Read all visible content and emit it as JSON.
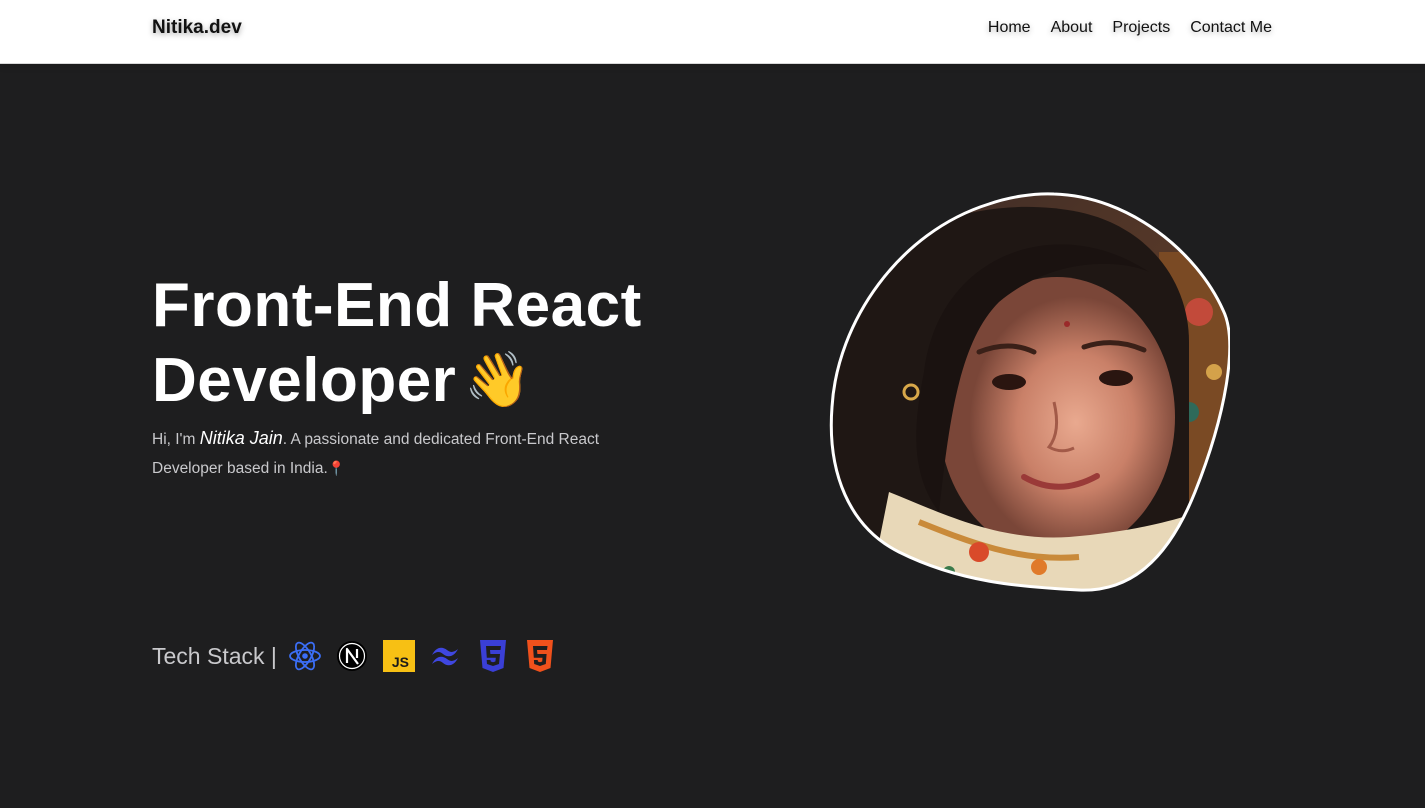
{
  "nav": {
    "brand": "Nitika.dev",
    "links": [
      "Home",
      "About",
      "Projects",
      "Contact Me"
    ]
  },
  "hero": {
    "title_line1": "Front-End React",
    "title_line2": "Developer",
    "wave_emoji": "👋",
    "intro_prefix": "Hi, I'm ",
    "name": "Nitika Jain",
    "intro_suffix": ". A passionate and dedicated Front-End React Developer based in India.",
    "pin_emoji": "📍"
  },
  "tech_stack": {
    "label": "Tech Stack |",
    "icons": [
      {
        "name": "react-icon",
        "color": "#3b6ef5"
      },
      {
        "name": "nextjs-icon",
        "color": "#000000"
      },
      {
        "name": "javascript-icon",
        "color": "#f7c014"
      },
      {
        "name": "tailwind-icon",
        "color": "#3f47e0"
      },
      {
        "name": "css3-icon",
        "color": "#3a3fd6"
      },
      {
        "name": "html5-icon",
        "color": "#f0511c"
      }
    ]
  },
  "colors": {
    "background": "#1e1e1f",
    "navbar": "#ffffff",
    "accent_text": "#ffffff"
  }
}
